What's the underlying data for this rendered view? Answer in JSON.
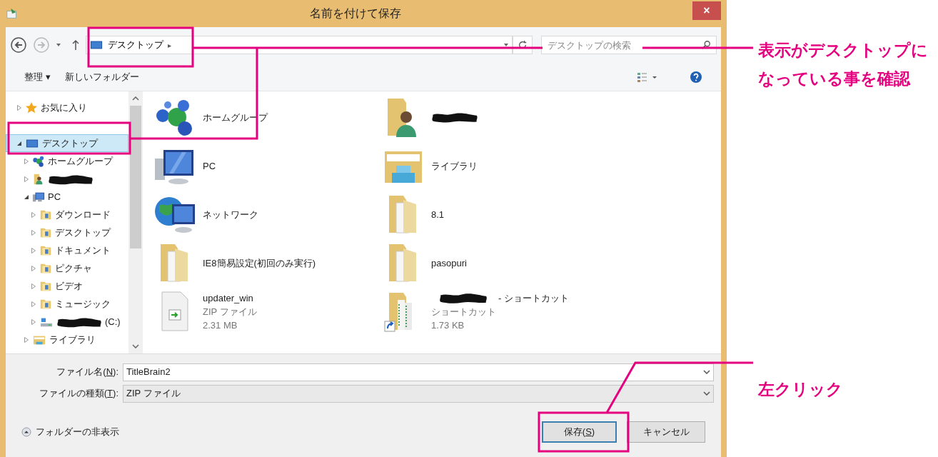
{
  "window": {
    "title": "名前を付けて保存",
    "close": "×"
  },
  "address": {
    "crumbs": [
      {
        "label": "デスクトップ",
        "separator": "▸"
      }
    ],
    "search_placeholder": "デスクトップの検索"
  },
  "toolbar": {
    "organize": "整理 ▾",
    "new_folder": "新しいフォルダー"
  },
  "nav": {
    "items": [
      {
        "label": "お気に入り",
        "kind": "star",
        "expanded": false,
        "selected": false
      },
      {
        "label": "デスクトップ",
        "kind": "desktop",
        "expanded": true,
        "selected": true,
        "children": [
          {
            "label": "ホームグループ",
            "kind": "homegroup",
            "expanded": false,
            "selected": false
          },
          {
            "redacted": true,
            "kind": "user",
            "expanded": false,
            "selected": false
          },
          {
            "label": "PC",
            "kind": "pc",
            "expanded": true,
            "selected": false,
            "children": [
              {
                "label": "ダウンロード",
                "kind": "folder",
                "expanded": false,
                "selected": false
              },
              {
                "label": "デスクトップ",
                "kind": "folder",
                "expanded": false,
                "selected": false
              },
              {
                "label": "ドキュメント",
                "kind": "folder",
                "expanded": false,
                "selected": false
              },
              {
                "label": "ピクチャ",
                "kind": "folder",
                "expanded": false,
                "selected": false
              },
              {
                "label": "ビデオ",
                "kind": "folder",
                "expanded": false,
                "selected": false
              },
              {
                "label": "ミュージック",
                "kind": "folder",
                "expanded": false,
                "selected": false
              },
              {
                "label": "(C:)",
                "redacted": true,
                "kind": "drive",
                "expanded": false,
                "selected": false
              }
            ]
          },
          {
            "label": "ライブラリ",
            "kind": "library",
            "expanded": false,
            "selected": false
          }
        ]
      }
    ]
  },
  "files": [
    {
      "name": "ホームグループ",
      "kind": "homegroup"
    },
    {
      "redacted": true,
      "kind": "user"
    },
    {
      "name": "PC",
      "kind": "pc"
    },
    {
      "name": "ライブラリ",
      "kind": "library"
    },
    {
      "name": "ネットワーク",
      "kind": "network"
    },
    {
      "name": "8.1",
      "kind": "folder"
    },
    {
      "name": "IE8簡易設定(初回のみ実行)",
      "kind": "folder"
    },
    {
      "name": "pasopuri",
      "kind": "folder"
    },
    {
      "name": "updater_win",
      "kind": "zip",
      "details": [
        "ZIP ファイル",
        "2.31 MB"
      ]
    },
    {
      "redacted": true,
      "name": "- ショートカット",
      "kind": "shortcut",
      "details": [
        "ショートカット",
        "1.73 KB"
      ]
    }
  ],
  "form": {
    "filename": {
      "label_before": "ファイル名(",
      "access_key": "N",
      "label_after": "):",
      "value": "TitleBrain2"
    },
    "filetype": {
      "label_before": "ファイルの種類(",
      "access_key": "T",
      "label_after": "):",
      "value": "ZIP ファイル"
    }
  },
  "footer": {
    "hide_folders": "フォルダーの非表示",
    "save": {
      "label_before": "保存(",
      "access_key": "S",
      "label_after": ")"
    },
    "cancel": "キャンセル"
  },
  "annotations": [
    {
      "text": "表示がデスクトップになっている事を確認"
    },
    {
      "text": "左クリック"
    }
  ]
}
